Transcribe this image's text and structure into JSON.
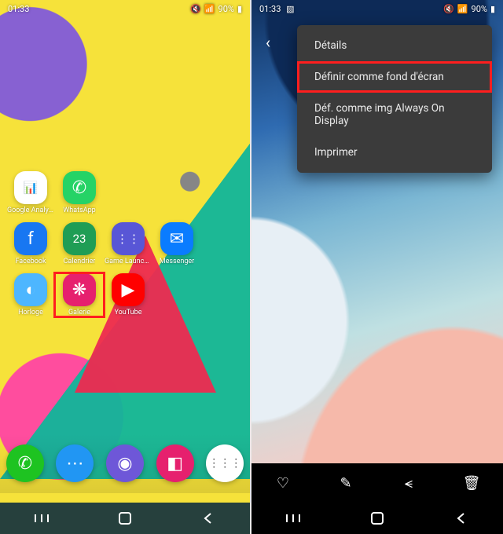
{
  "status": {
    "time": "01:33",
    "battery": "90%"
  },
  "left": {
    "apps": [
      {
        "name": "google-analytics",
        "label": "Google Analytics",
        "bg": "#ffffff",
        "glyph": "📊"
      },
      {
        "name": "whatsapp",
        "label": "WhatsApp",
        "bg": "#25d366",
        "glyph": "✆"
      },
      {
        "name": "facebook",
        "label": "Facebook",
        "bg": "#1877f2",
        "glyph": "f"
      },
      {
        "name": "calendrier",
        "label": "Calendrier",
        "bg": "#1f9d55",
        "glyph": "23"
      },
      {
        "name": "game-launcher",
        "label": "Game Launcher",
        "bg": "#5856d6",
        "glyph": "⋮⋮"
      },
      {
        "name": "messenger",
        "label": "Messenger",
        "bg": "#0a7cff",
        "glyph": "✉"
      },
      {
        "name": "horloge",
        "label": "Horloge",
        "bg": "#4db6ff",
        "glyph": "◐"
      },
      {
        "name": "galerie",
        "label": "Galerie",
        "bg": "#e6206e",
        "glyph": "❋"
      },
      {
        "name": "youtube",
        "label": "YouTube",
        "bg": "#ff0000",
        "glyph": "▶"
      }
    ],
    "highlighted_app_index": 7,
    "dock": [
      {
        "name": "phone",
        "bg": "#1ec321",
        "glyph": "✆"
      },
      {
        "name": "messages",
        "bg": "#2196f3",
        "glyph": "⋯"
      },
      {
        "name": "browser",
        "bg": "#6e57d8",
        "glyph": "◉"
      },
      {
        "name": "camera",
        "bg": "#e6206e",
        "glyph": "◧"
      },
      {
        "name": "apps",
        "bg": "#ffffff",
        "glyph": "⋮⋮⋮"
      }
    ]
  },
  "right": {
    "menu": [
      {
        "key": "details",
        "label": "Détails"
      },
      {
        "key": "wallpaper",
        "label": "Définir comme fond d'écran"
      },
      {
        "key": "aod",
        "label": "Déf. comme img Always On Display"
      },
      {
        "key": "print",
        "label": "Imprimer"
      }
    ],
    "highlighted_menu_index": 1
  }
}
